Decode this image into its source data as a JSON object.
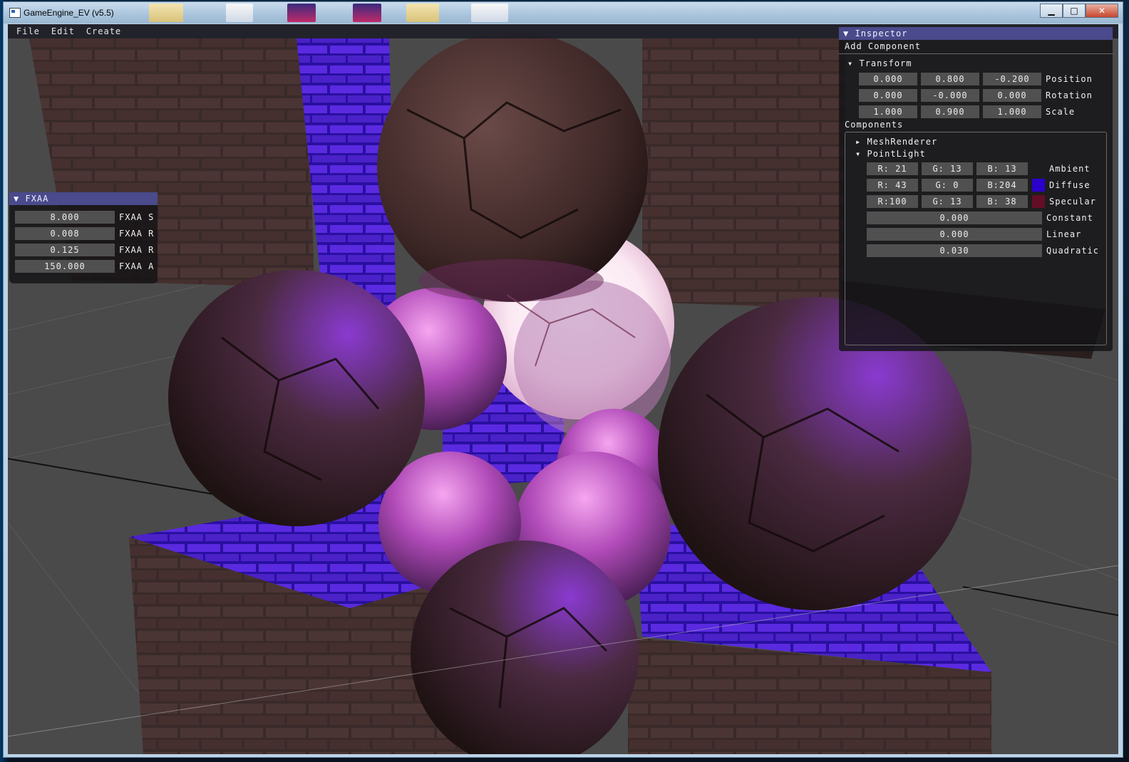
{
  "window": {
    "title": "GameEngine_EV (v5.5)",
    "minimize": "▁",
    "maximize": "□",
    "close": "✕"
  },
  "menu": {
    "items": [
      "File",
      "Edit",
      "Create"
    ]
  },
  "fxaa": {
    "title": "FXAA",
    "rows": [
      {
        "value": "8.000",
        "label": "FXAA S"
      },
      {
        "value": "0.008",
        "label": "FXAA R"
      },
      {
        "value": "0.125",
        "label": "FXAA R"
      },
      {
        "value": "150.000",
        "label": "FXAA A"
      }
    ]
  },
  "inspector": {
    "title": "Inspector",
    "add_component": "Add Component",
    "transform": {
      "title": "Transform",
      "position": {
        "x": "0.000",
        "y": "0.800",
        "z": "-0.200",
        "label": "Position"
      },
      "rotation": {
        "x": "0.000",
        "y": "-0.000",
        "z": "0.000",
        "label": "Rotation"
      },
      "scale": {
        "x": "1.000",
        "y": "0.900",
        "z": "1.000",
        "label": "Scale"
      }
    },
    "components_label": "Components",
    "mesh_renderer": "MeshRenderer",
    "point_light": {
      "title": "PointLight",
      "ambient": {
        "r": "R: 21",
        "g": "G: 13",
        "b": "B: 13",
        "label": "Ambient"
      },
      "diffuse": {
        "r": "R: 43",
        "g": "G:  0",
        "b": "B:204",
        "label": "Diffuse",
        "swatch": "#2b00cc"
      },
      "specular": {
        "r": "R:100",
        "g": "G: 13",
        "b": "B: 38",
        "label": "Specular",
        "swatch": "#640d26"
      },
      "constant": {
        "value": "0.000",
        "label": "Constant"
      },
      "linear": {
        "value": "0.000",
        "label": "Linear"
      },
      "quadratic": {
        "value": "0.030",
        "label": "Quadratic"
      }
    }
  },
  "icons": {
    "panel_collapse": "▼",
    "tree_open": "▾",
    "tree_closed": "▸"
  }
}
